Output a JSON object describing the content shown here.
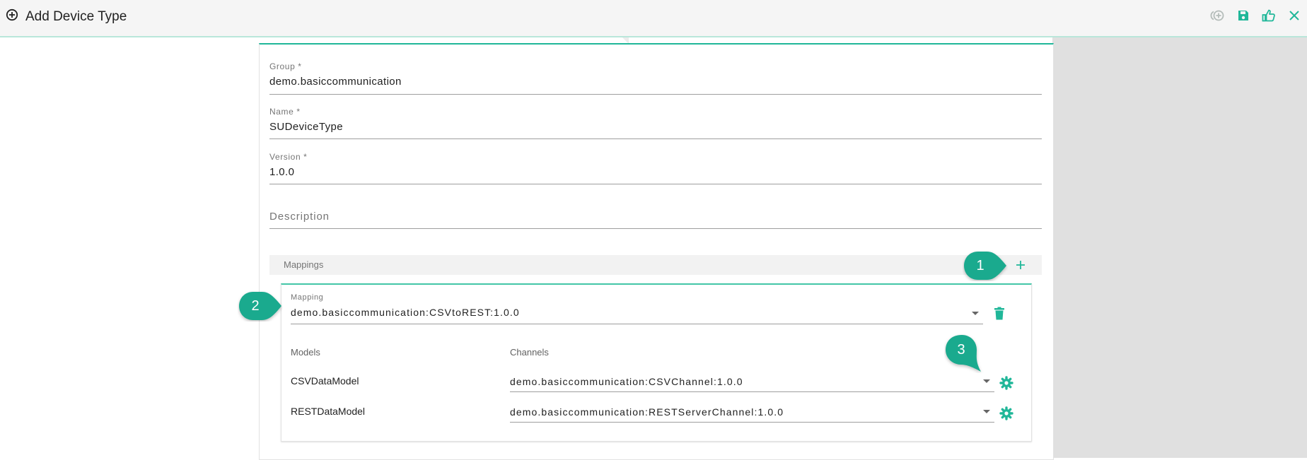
{
  "header": {
    "title": "Add Device Type",
    "actions": [
      {
        "name": "add-circle-icon",
        "color": "#b4bcb9"
      },
      {
        "name": "save-icon",
        "color": "#20b799"
      },
      {
        "name": "thumbs-up-icon",
        "color": "#20b799"
      },
      {
        "name": "close-icon",
        "color": "#20b799"
      }
    ]
  },
  "form": {
    "group": {
      "label": "Group *",
      "value": "demo.basiccommunication"
    },
    "name": {
      "label": "Name *",
      "value": "SUDeviceType"
    },
    "version": {
      "label": "Version *",
      "value": "1.0.0"
    },
    "description": {
      "placeholder": "Description"
    }
  },
  "mappings": {
    "header_label": "Mappings",
    "mapping": {
      "label": "Mapping",
      "value": "demo.basiccommunication:CSVtoREST:1.0.0"
    },
    "models_header": "Models",
    "channels_header": "Channels",
    "rows": [
      {
        "model": "CSVDataModel",
        "channel": "demo.basiccommunication:CSVChannel:1.0.0"
      },
      {
        "model": "RESTDataModel",
        "channel": "demo.basiccommunication:RESTServerChannel:1.0.0"
      }
    ]
  },
  "callouts": [
    "1",
    "2",
    "3"
  ],
  "colors": {
    "accent": "#20b799",
    "callout": "#1aaa8e"
  }
}
